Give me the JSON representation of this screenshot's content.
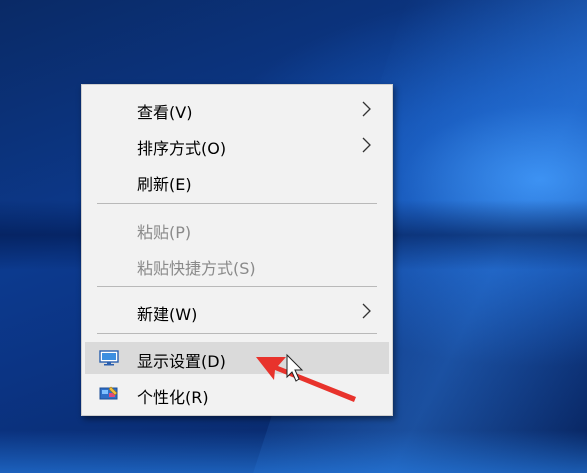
{
  "context_menu": {
    "items": [
      {
        "label": "查看(V)",
        "has_submenu": true,
        "enabled": true
      },
      {
        "label": "排序方式(O)",
        "has_submenu": true,
        "enabled": true
      },
      {
        "label": "刷新(E)",
        "has_submenu": false,
        "enabled": true
      },
      {
        "label": "粘贴(P)",
        "has_submenu": false,
        "enabled": false
      },
      {
        "label": "粘贴快捷方式(S)",
        "has_submenu": false,
        "enabled": false
      },
      {
        "label": "新建(W)",
        "has_submenu": true,
        "enabled": true
      },
      {
        "label": "显示设置(D)",
        "has_submenu": false,
        "enabled": true,
        "highlighted": true,
        "icon": "display-icon"
      },
      {
        "label": "个性化(R)",
        "has_submenu": false,
        "enabled": true,
        "icon": "personalize-icon"
      }
    ]
  },
  "annotation": {
    "arrow_color": "#e8332c"
  }
}
